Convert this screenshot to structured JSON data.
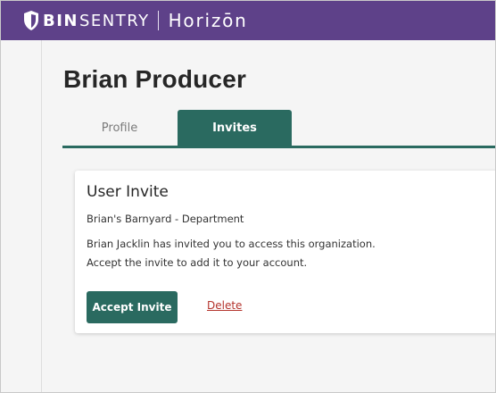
{
  "header": {
    "brand_bin": "BIN",
    "brand_sentry": "SENTRY",
    "brand_product": "Horizōn",
    "logo_icon": "shield-icon",
    "background_color": "#5e4189"
  },
  "page": {
    "title": "Brian Producer"
  },
  "tabs": [
    {
      "label": "Profile",
      "active": false
    },
    {
      "label": "Invites",
      "active": true
    }
  ],
  "invite_card": {
    "title": "User Invite",
    "organization": "Brian's Barnyard - Department",
    "message_line1": "Brian Jacklin has invited you to access this organization.",
    "message_line2": "Accept the invite to add it to your account.",
    "accept_label": "Accept Invite",
    "delete_label": "Delete"
  },
  "colors": {
    "accent": "#2a6a60",
    "danger_link": "#b4332c",
    "header": "#5e4189"
  }
}
